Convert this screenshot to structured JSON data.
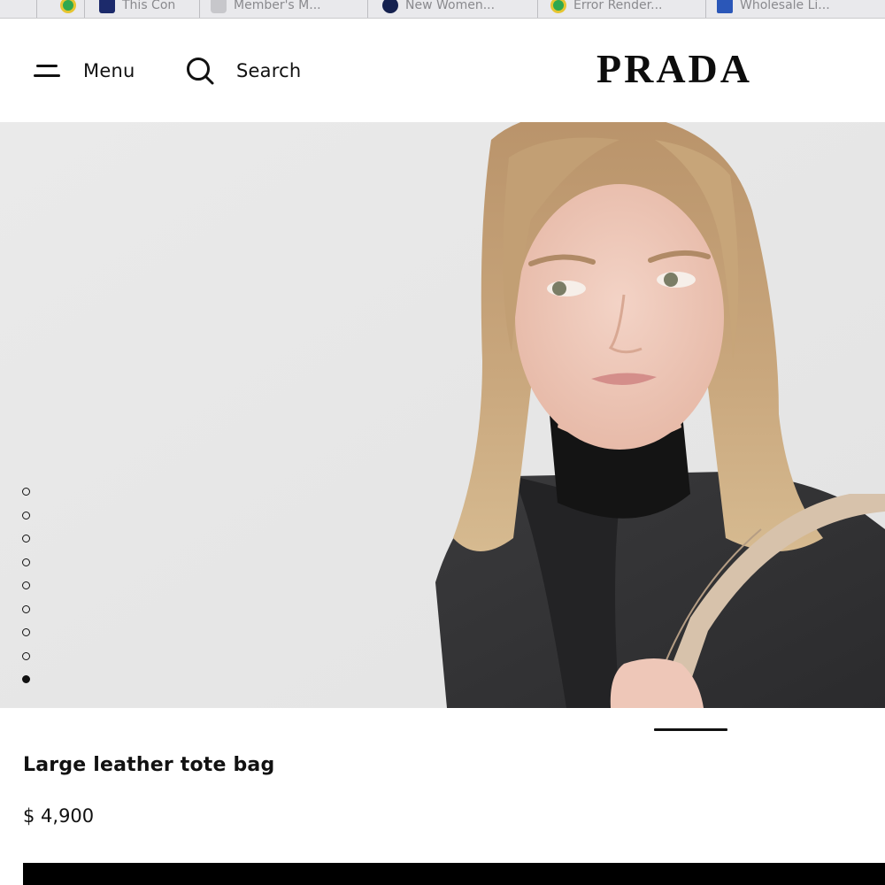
{
  "browser": {
    "tabs": [
      {
        "title": "This Con",
        "favicon": "chrome-icon"
      },
      {
        "title": "Member's M...",
        "favicon": "generic-page-icon"
      },
      {
        "title": "New Women...",
        "favicon": "bow-icon"
      },
      {
        "title": "Error Render...",
        "favicon": "chrome-icon"
      },
      {
        "title": "Wholesale Li...",
        "favicon": "blue-b-icon"
      }
    ]
  },
  "header": {
    "menu_label": "Menu",
    "search_label": "Search",
    "logo_text": "PRADA"
  },
  "gallery": {
    "image_count": 9,
    "active_index": 9
  },
  "product": {
    "name": "Large leather tote bag",
    "price": "$ 4,900"
  },
  "colors": {
    "primary": "#111111",
    "background": "#ffffff",
    "hero_background": "#e8e8e8"
  }
}
